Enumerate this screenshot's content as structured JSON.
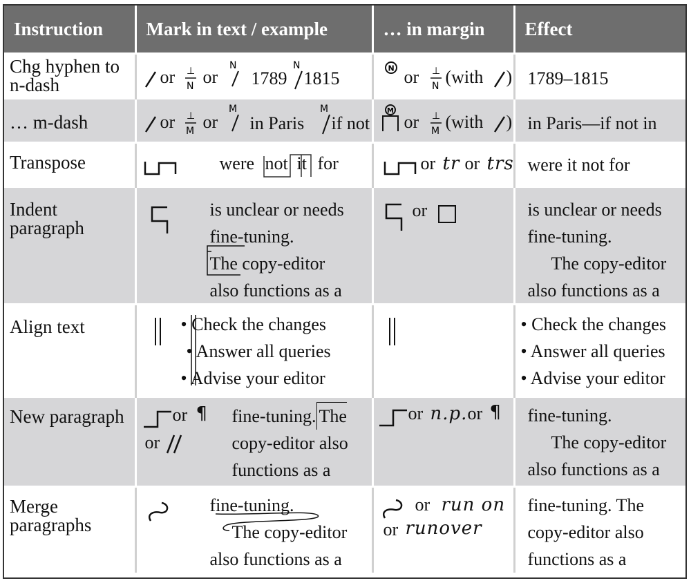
{
  "headers": {
    "instruction": "Instruction",
    "mark": "Mark in text / example",
    "margin": "… in margin",
    "effect": "Effect"
  },
  "rows": {
    "hyphen_ndash": {
      "instruction": "Chg hyphen to n-dash",
      "mark_or1": "or",
      "mark_or2": "or",
      "example_a": "1789",
      "example_b": "1815",
      "margin_or": "or",
      "margin_with": "(with",
      "margin_close": ")",
      "effect": "1789–1815"
    },
    "mdash": {
      "instruction": "… m-dash",
      "mark_or1": "or",
      "mark_or2": "or",
      "example_a": "in Paris",
      "example_b": "if not",
      "margin_or": "or",
      "margin_with": "(with",
      "margin_close": ")",
      "effect": "in Paris—if not in"
    },
    "transpose": {
      "instruction": "Transpose",
      "example_were": "were",
      "example_not": "not",
      "example_it": "it",
      "example_for": "for",
      "margin_or1": "or",
      "margin_tr": "tr",
      "margin_or2": "or",
      "margin_trs": "trs",
      "effect": "were it not for"
    },
    "indent": {
      "instruction": "Indent paragraph",
      "example_lines": [
        "is unclear or needs",
        "fine-tuning.",
        "The copy-editor",
        "also functions as a"
      ],
      "margin_or": "or",
      "effect_lines": [
        "is unclear or needs",
        "fine-tuning.",
        "The copy-editor",
        "also functions as a"
      ]
    },
    "align": {
      "instruction": "Align text",
      "example_lines": [
        "Check the changes",
        "Answer all queries",
        "Advise your editor"
      ],
      "effect_lines": [
        "Check the changes",
        "Answer all queries",
        "Advise your editor"
      ]
    },
    "new_para": {
      "instruction": "New paragraph",
      "mark_or1": "or",
      "mark_or2": "or",
      "example_lines": [
        "fine-tuning.",
        "The",
        "copy-editor also",
        "functions as a"
      ],
      "margin_or1": "or",
      "margin_np": "n.p.",
      "margin_or2": "or",
      "effect_lines": [
        "fine-tuning.",
        "The copy-editor",
        "also functions as a"
      ]
    },
    "merge": {
      "instruction": "Merge paragraphs",
      "example_lines": [
        "fine-tuning.",
        "The copy-editor",
        "also functions as a"
      ],
      "margin_or1": "or",
      "margin_run_on": "run on",
      "margin_or2": "or",
      "margin_runover": "runover",
      "effect_lines": [
        "fine-tuning. The",
        "copy-editor also",
        "functions as a"
      ]
    }
  }
}
